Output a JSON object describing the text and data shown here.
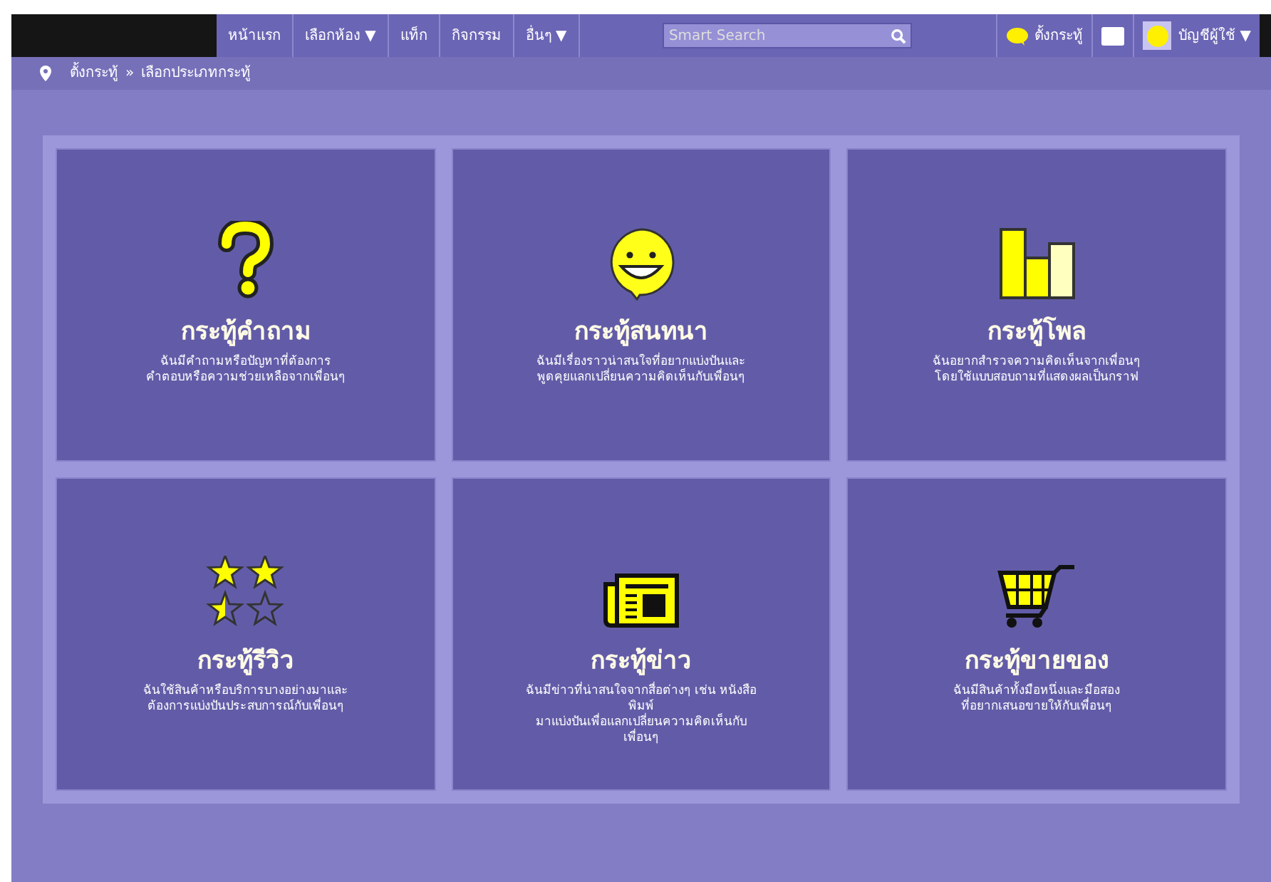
{
  "nav": {
    "items": [
      "หน้าแรก",
      "เลือกห้อง ▼",
      "แท็ก",
      "กิจกรรม",
      "อื่นๆ ▼"
    ],
    "search": {
      "placeholder": "Smart Search"
    },
    "post_button": "ตั้งกระทู้",
    "account": "บัญชีผู้ใช้ ▼"
  },
  "breadcrumb": {
    "items": [
      "ตั้งกระทู้",
      "เลือกประเภทกระทู้"
    ],
    "separator": "»"
  },
  "cards": [
    {
      "kind": "question",
      "title": "กระทู้คำถาม",
      "lines": [
        "ฉันมีคำถามหรือปัญหาที่ต้องการ",
        "คำตอบหรือความช่วยเหลือจากเพื่อนๆ"
      ]
    },
    {
      "kind": "chat",
      "title": "กระทู้สนทนา",
      "lines": [
        "ฉันมีเรื่องราวน่าสนใจที่อยากแบ่งปันและ",
        "พูดคุยแลกเปลี่ยนความคิดเห็นกับเพื่อนๆ"
      ]
    },
    {
      "kind": "poll",
      "title": "กระทู้โพล",
      "lines": [
        "ฉันอยากสำรวจความคิดเห็นจากเพื่อนๆ",
        "โดยใช้แบบสอบถามที่แสดงผลเป็นกราฟ"
      ]
    },
    {
      "kind": "review",
      "title": "กระทู้รีวิว",
      "lines": [
        "ฉันใช้สินค้าหรือบริการบางอย่างมาและ",
        "ต้องการแบ่งปันประสบการณ์กับเพื่อนๆ"
      ]
    },
    {
      "kind": "news",
      "title": "กระทู้ข่าว",
      "lines": [
        "ฉันมีข่าวที่น่าสนใจจากสื่อต่างๆ เช่น หนังสือ",
        "พิมพ์",
        "มาแบ่งปันเพื่อแลกเปลี่ยนความคิดเห็นกับ",
        "เพื่อนๆ"
      ]
    },
    {
      "kind": "sell",
      "title": "กระทู้ขายของ",
      "lines": [
        "ฉันมีสินค้าทั้งมือหนึ่งและมือสอง",
        "ที่อยากเสนอขายให้กับเพื่อนๆ"
      ]
    }
  ]
}
